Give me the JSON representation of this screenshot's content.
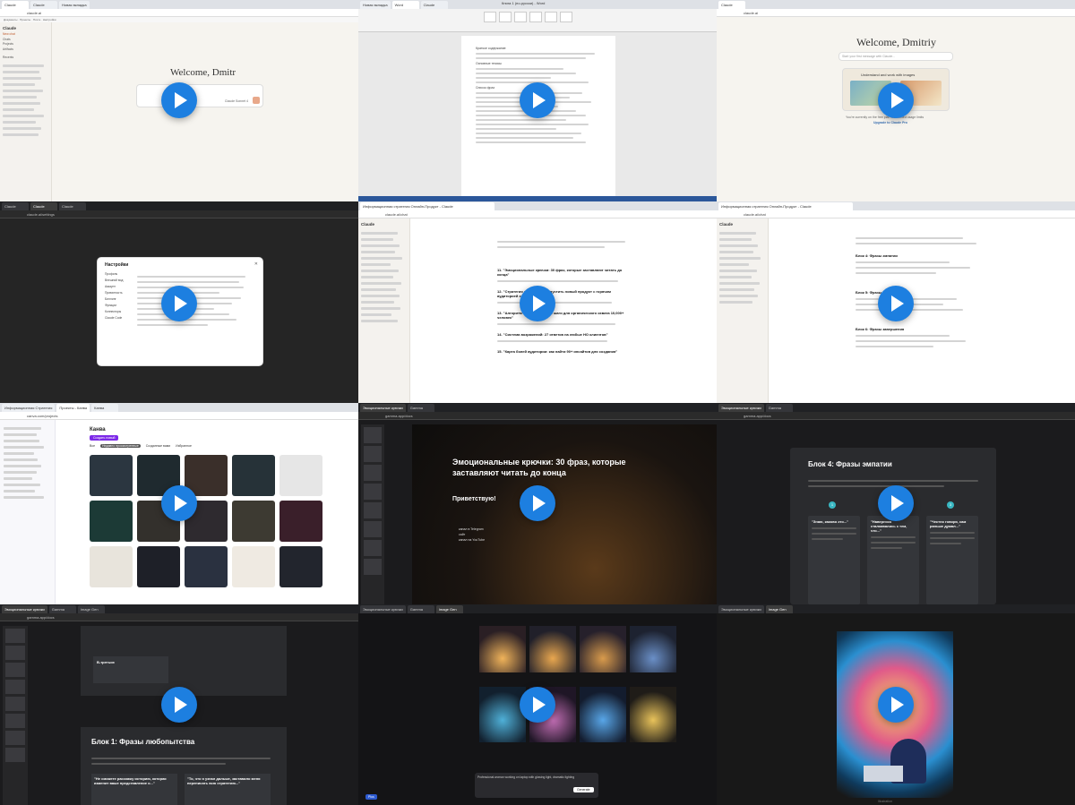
{
  "tiles": [
    {
      "id": "t1",
      "tabs": [
        "Claude",
        "Claude",
        "Новая вкладка"
      ],
      "url": "claude.ai",
      "welcome": "Welcome, Dmitr",
      "sidebar": [
        "New chat",
        "Chats",
        "Projects",
        "Artifacts",
        "Recents"
      ],
      "model": "Claude Sonnet 4"
    },
    {
      "id": "t2",
      "tabs": [
        "Новая вкладка",
        "Word",
        "Claude"
      ],
      "doc_title": "Книга 1 (по-русски) - Word",
      "lines": [
        "Краткое содержание",
        "Основные тезисы",
        "Список фраз"
      ]
    },
    {
      "id": "t3",
      "tabs": [
        "Claude"
      ],
      "url": "claude.ai",
      "welcome": "Welcome, Dmitriy",
      "input_placeholder": "Start your first message with Claude...",
      "card_title": "Understand and work with images",
      "footer": "You're currently on the free plan with limited usage limits",
      "upgrade": "Upgrade to Claude Pro"
    },
    {
      "id": "t4",
      "tabs": [
        "Claude",
        "Claude",
        "Claude"
      ],
      "dialog_title": "Настройки",
      "menu": [
        "Профиль",
        "Внешний вид",
        "Аккаунт",
        "Приватность",
        "Биллинг",
        "Функции",
        "Коннекторы",
        "Claude Code"
      ]
    },
    {
      "id": "t5",
      "tabs": [
        "Информационная стратегия Онлайн-Продукт - Claude"
      ],
      "heading_1": "11. \"Эмоциональные крючки: 30 фраз, которые заставляют читать до конца\"",
      "heading_2": "12. \"Стратегия запуска: как запустить новый продукт с горячим аудиторией за 30 дней\"",
      "heading_3": "13. \"Алгоритм «Путь»: готовые шаги для органического охвата 10,000+ человек\"",
      "heading_4": "14. \"Система возражений: 27 ответов на любые НО клиентов\"",
      "heading_5": "15. \"Карта болей аудитории: как найти 90+ инсайтов для создания\""
    },
    {
      "id": "t6",
      "tabs": [
        "Информационная стратегия Онлайн-Продукт - Claude"
      ],
      "block_heading_1": "Блок 4: Фразы эмпатии",
      "block_heading_2": "Блок 5: Фразы действия",
      "block_heading_3": "Блок 6: Фразы завершения"
    },
    {
      "id": "t7",
      "tabs": [
        "Информационная Стратегия",
        "Проекты - Канва",
        "Канва"
      ],
      "header": "Канва",
      "tabs_row": [
        "Все",
        "Недавно просмотренные",
        "Созданные вами",
        "Избранное"
      ],
      "create_button": "Создать новый"
    },
    {
      "id": "t8",
      "tabs": [
        "Эмоциональные крючки",
        "Gamma"
      ],
      "slide_title": "Эмоциональные крючки: 30 фраз, которые заставляют читать до конца",
      "greeting": "Приветствую!",
      "bullets": [
        "канал в Telegram",
        "сайт",
        "канал на YouTube"
      ]
    },
    {
      "id": "t9",
      "tabs": [
        "Эмоциональные крючки",
        "Gamma"
      ],
      "slide_title": "Блок 4: Фразы эмпатии",
      "cards": [
        "\"Знаю, каково это...\"",
        "\"Наверняка сталкивались с тем, что...\"",
        "\"Честно говоря, сам раньше думал...\""
      ],
      "steps": [
        "1",
        "2",
        "3"
      ]
    },
    {
      "id": "t10",
      "tabs": [
        "Эмоциональные крючки",
        "Gamma",
        "Image Gen"
      ],
      "card_a": "В-третьих",
      "slide_title": "Блок 1: Фразы любопытства",
      "card_b": "\"Не сможете расскажу историю, которая изменит ваше представление о...\"",
      "card_c": "\"То, что я узнал дальше, заставило меня переписать всю стратегию...\""
    },
    {
      "id": "t11",
      "tabs": [
        "Эмоциональные крючки",
        "Gamma",
        "Image Gen"
      ],
      "prompt": "Professional woman working on laptop with glowing light, dramatic lighting",
      "button": "Generate",
      "plan": "Plus"
    },
    {
      "id": "t12",
      "tabs": [
        "Эмоциональные крючки",
        "Image Gen"
      ],
      "caption": "Illustration"
    }
  ]
}
